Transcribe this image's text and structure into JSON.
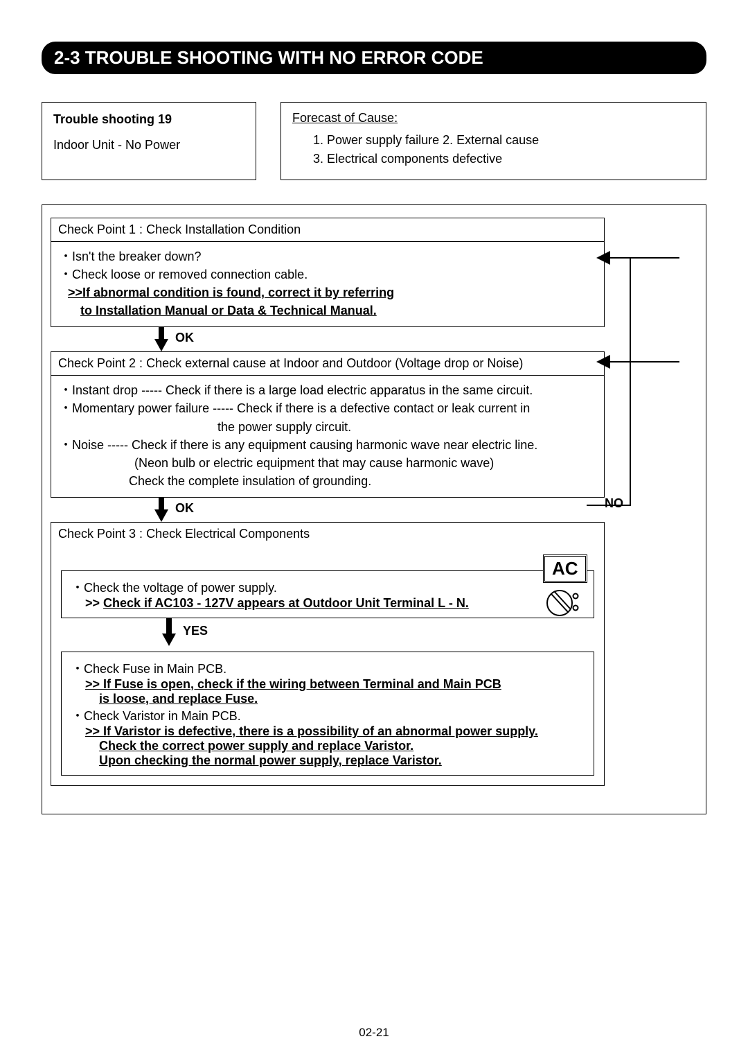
{
  "section_title": "2-3 TROUBLE SHOOTING WITH NO ERROR CODE",
  "ts": {
    "number_label": "Trouble shooting 19",
    "unit_label": "Indoor Unit - No Power"
  },
  "forecast": {
    "title": "Forecast of  Cause:",
    "line1": "1. Power supply failure    2. External cause",
    "line2": "3. Electrical components defective"
  },
  "cp1": {
    "header": "Check Point 1 : Check Installation Condition",
    "b1": "Isn't the breaker down?",
    "b2": "Check loose or removed connection cable.",
    "action1": ">>If abnormal condition is found, correct it by referring",
    "action2": "to Installation Manual or Data & Technical Manual."
  },
  "conn1_label": "OK",
  "cp2": {
    "header": "Check Point 2 : Check external cause at Indoor and Outdoor (Voltage drop or Noise)",
    "b1": "Instant drop ----- Check if there is a large load electric apparatus in the same circuit.",
    "b2a": "Momentary power failure ----- Check if there is a defective contact or leak current in",
    "b2b": "the power supply circuit.",
    "b3a": "Noise ----- Check if there is any equipment causing harmonic wave near electric line.",
    "b3b": "(Neon bulb or electric equipment that may cause harmonic wave)",
    "b3c": "Check the complete insulation of grounding."
  },
  "conn2_label": "OK",
  "cp3": {
    "header": "Check Point 3 : Check Electrical Components",
    "ac_label": "AC",
    "sub1": {
      "b1": "Check the voltage of power supply.",
      "action": ">> Check if AC103 - 127V appears at Outdoor Unit Terminal L - N."
    },
    "yes_label": "YES",
    "sub2": {
      "b1": "Check Fuse in Main PCB.",
      "a1a": ">> If Fuse is open, check if the wiring between Terminal and Main PCB",
      "a1b": "is loose, and replace Fuse.",
      "b2": "Check Varistor in Main PCB.",
      "a2a": ">> If  Varistor is defective, there is a possibility of an abnormal power supply.",
      "a2b": "Check the correct power supply and replace Varistor.",
      "a2c": "Upon checking the normal power supply, replace Varistor."
    }
  },
  "no_label": "NO",
  "page_number": "02-21"
}
